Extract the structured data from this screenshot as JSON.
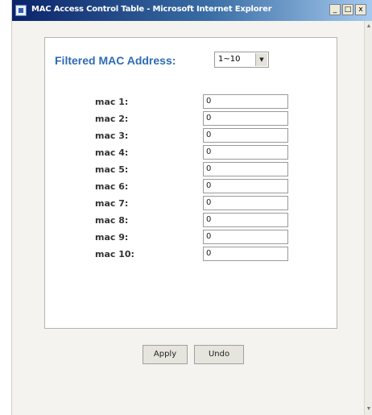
{
  "window": {
    "title": "MAC Access Control Table - Microsoft Internet Explorer",
    "caption": {
      "minimize": "_",
      "maximize": "□",
      "close": "x"
    }
  },
  "filter": {
    "label": "Filtered MAC Address:",
    "selected": "1~10",
    "dropdown_icon": "▼"
  },
  "mac_entries": [
    {
      "label": "mac 1:",
      "value": "0"
    },
    {
      "label": "mac 2:",
      "value": "0"
    },
    {
      "label": "mac 3:",
      "value": "0"
    },
    {
      "label": "mac 4:",
      "value": "0"
    },
    {
      "label": "mac 5:",
      "value": "0"
    },
    {
      "label": "mac 6:",
      "value": "0"
    },
    {
      "label": "mac 7:",
      "value": "0"
    },
    {
      "label": "mac 8:",
      "value": "0"
    },
    {
      "label": "mac 9:",
      "value": "0"
    },
    {
      "label": "mac 10:",
      "value": "0"
    }
  ],
  "buttons": {
    "apply": "Apply",
    "undo": "Undo"
  },
  "icons": {
    "window_icon": "ie-page-icon",
    "scroll_up": "▲",
    "scroll_down": "▼"
  },
  "colors": {
    "label_blue": "#2e6bb5",
    "titlebar": "#0a246a"
  }
}
